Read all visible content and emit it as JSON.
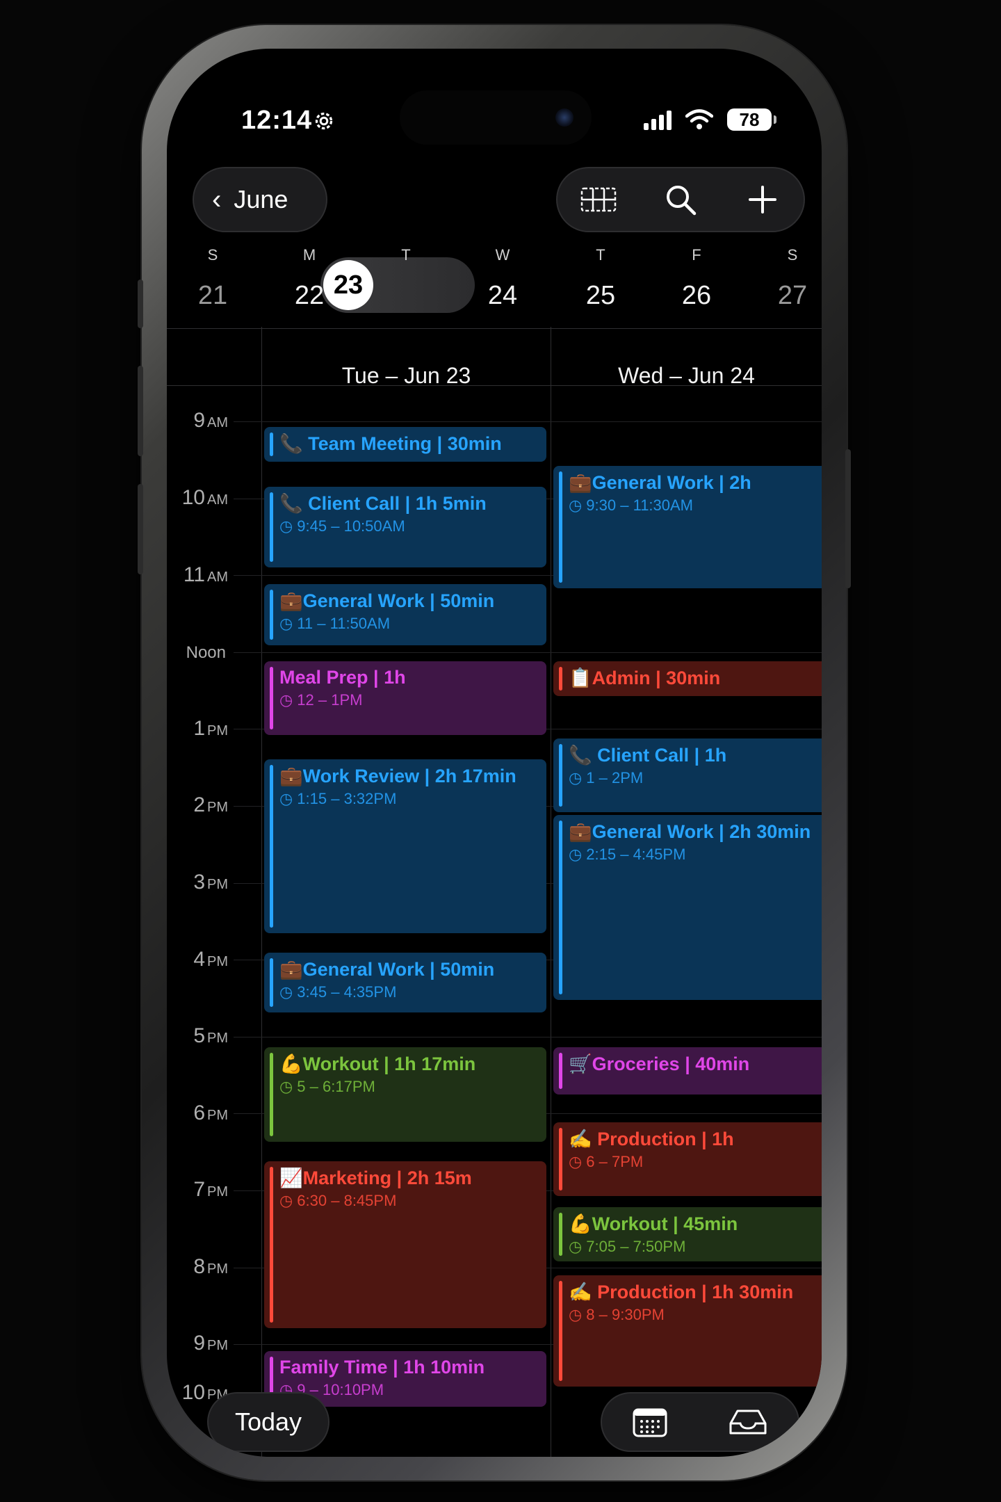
{
  "status": {
    "time": "12:14",
    "battery": "78"
  },
  "nav": {
    "back_label": "June"
  },
  "week": {
    "days": [
      {
        "wd": "S",
        "num": "21"
      },
      {
        "wd": "M",
        "num": "22"
      },
      {
        "wd": "T",
        "num": "23"
      },
      {
        "wd": "W",
        "num": "24"
      },
      {
        "wd": "T",
        "num": "25"
      },
      {
        "wd": "F",
        "num": "26"
      },
      {
        "wd": "S",
        "num": "27"
      }
    ]
  },
  "columns": [
    "Tue – Jun 23",
    "Wed – Jun 24"
  ],
  "hours": [
    {
      "h": "9",
      "p": "AM"
    },
    {
      "h": "10",
      "p": "AM"
    },
    {
      "h": "11",
      "p": "AM"
    },
    {
      "h": "Noon",
      "p": ""
    },
    {
      "h": "1",
      "p": "PM"
    },
    {
      "h": "2",
      "p": "PM"
    },
    {
      "h": "3",
      "p": "PM"
    },
    {
      "h": "4",
      "p": "PM"
    },
    {
      "h": "5",
      "p": "PM"
    },
    {
      "h": "6",
      "p": "PM"
    },
    {
      "h": "7",
      "p": "PM"
    },
    {
      "h": "8",
      "p": "PM"
    },
    {
      "h": "9",
      "p": "PM"
    },
    {
      "h": "10",
      "p": "PM"
    }
  ],
  "events_tue": [
    {
      "title": "📞 Team Meeting | 30min",
      "time": ""
    },
    {
      "title": "📞 Client Call | 1h 5min",
      "time": "◷ 9:45 – 10:50AM"
    },
    {
      "title": "💼General Work | 50min",
      "time": "◷ 11 – 11:50AM"
    },
    {
      "title": "Meal Prep | 1h",
      "time": "◷ 12 – 1PM"
    },
    {
      "title": "💼Work Review | 2h 17min",
      "time": "◷ 1:15 – 3:32PM"
    },
    {
      "title": "💼General Work | 50min",
      "time": "◷ 3:45 – 4:35PM"
    },
    {
      "title": "💪Workout | 1h 17min",
      "time": "◷ 5 – 6:17PM"
    },
    {
      "title": "📈Marketing | 2h 15m",
      "time": "◷ 6:30 – 8:45PM"
    },
    {
      "title": "Family Time | 1h 10min",
      "time": "◷ 9 – 10:10PM"
    }
  ],
  "events_wed": [
    {
      "title": "💼General Work | 2h",
      "time": "◷ 9:30 – 11:30AM"
    },
    {
      "title": "📋Admin | 30min",
      "time": ""
    },
    {
      "title": "📞 Client Call | 1h",
      "time": "◷ 1 – 2PM"
    },
    {
      "title": "💼General Work | 2h 30min",
      "time": "◷ 2:15 – 4:45PM"
    },
    {
      "title": "🛒Groceries | 40min",
      "time": ""
    },
    {
      "title": "✍️ Production | 1h",
      "time": "◷ 6 – 7PM"
    },
    {
      "title": "💪Workout | 45min",
      "time": "◷ 7:05 – 7:50PM"
    },
    {
      "title": "✍️ Production | 1h 30min",
      "time": "◷ 8 – 9:30PM"
    }
  ],
  "bottom": {
    "today_label": "Today"
  }
}
